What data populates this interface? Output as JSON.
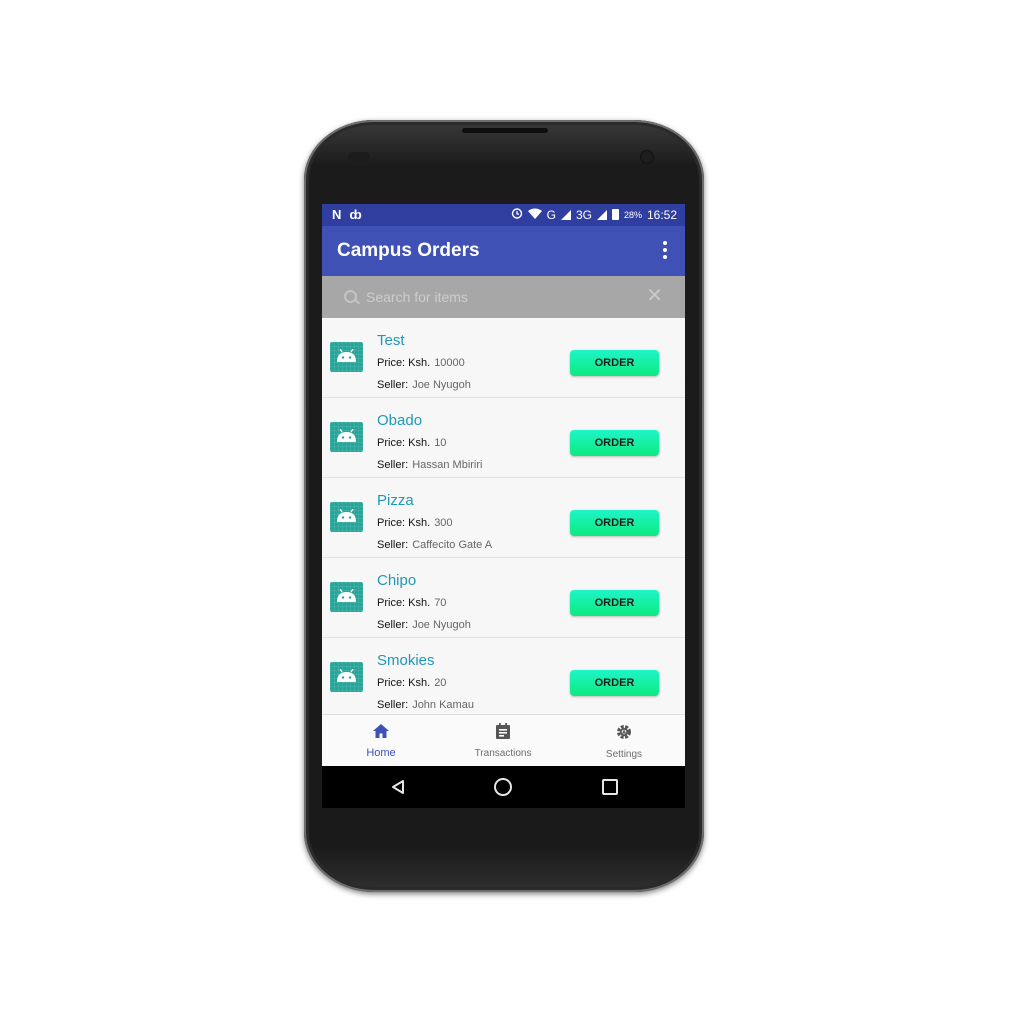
{
  "status_bar": {
    "left_icons": [
      "N",
      "ȸ"
    ],
    "right_text": {
      "network_g": "G",
      "network_3g": "3G",
      "battery": "28%",
      "time": "16:52"
    }
  },
  "app_bar": {
    "title": "Campus Orders"
  },
  "search": {
    "placeholder": "Search for items"
  },
  "items": [
    {
      "name": "Test",
      "price_label": "Price: Ksh.",
      "price": "10000",
      "seller_label": "Seller:",
      "seller": "Joe Nyugoh",
      "button": "ORDER"
    },
    {
      "name": "Obado",
      "price_label": "Price: Ksh.",
      "price": "10",
      "seller_label": "Seller:",
      "seller": "Hassan Mbiriri",
      "button": "ORDER"
    },
    {
      "name": "Pizza",
      "price_label": "Price: Ksh.",
      "price": "300",
      "seller_label": "Seller:",
      "seller": "Caffecito Gate A",
      "button": "ORDER"
    },
    {
      "name": "Chipo",
      "price_label": "Price: Ksh.",
      "price": "70",
      "seller_label": "Seller:",
      "seller": "Joe Nyugoh",
      "button": "ORDER"
    },
    {
      "name": "Smokies",
      "price_label": "Price: Ksh.",
      "price": "20",
      "seller_label": "Seller:",
      "seller": "John Kamau",
      "button": "ORDER"
    }
  ],
  "bottom_nav": [
    {
      "label": "Home",
      "icon": "home-icon",
      "active": true
    },
    {
      "label": "Transactions",
      "icon": "list-icon",
      "active": false
    },
    {
      "label": "Settings",
      "icon": "gear-icon",
      "active": false
    }
  ],
  "colors": {
    "status_bar": "#303f9f",
    "app_bar": "#3f51b5",
    "item_title": "#1e98b8",
    "order_button": "#10ee9a",
    "thumb": "#26a69a"
  }
}
